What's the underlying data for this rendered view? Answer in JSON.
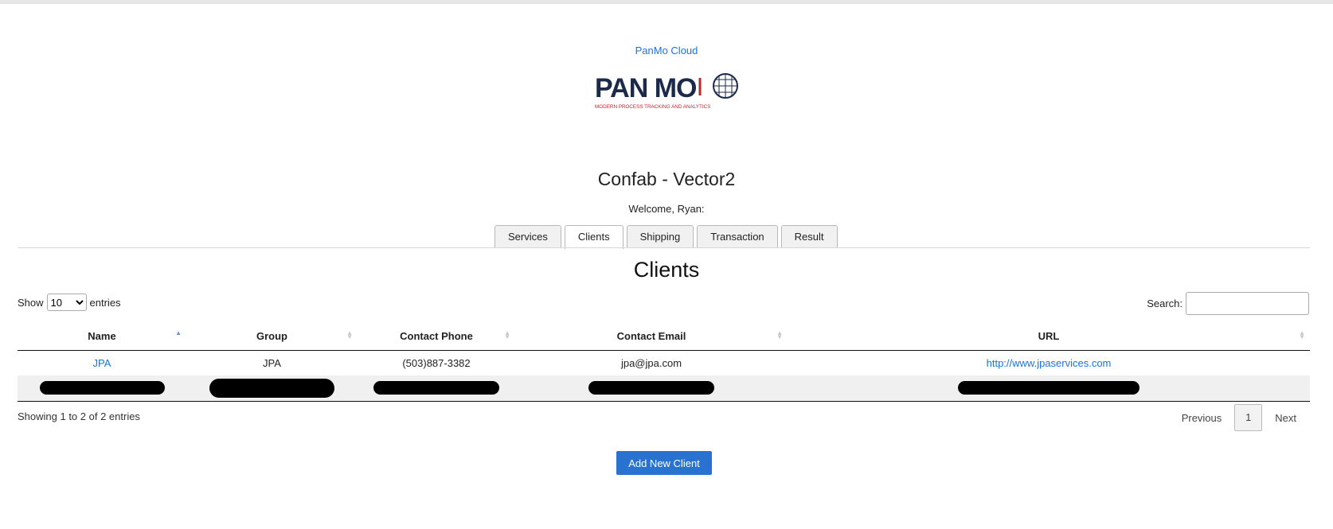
{
  "header": {
    "brand_link": "PanMo Cloud",
    "logo_text": "PAN MO",
    "logo_tagline": "MODERN PROCESS TRACKING AND ANALYTICS",
    "app_title": "Confab - Vector2",
    "welcome": "Welcome, Ryan:"
  },
  "tabs": [
    {
      "label": "Services",
      "active": false
    },
    {
      "label": "Clients",
      "active": true
    },
    {
      "label": "Shipping",
      "active": false
    },
    {
      "label": "Transaction",
      "active": false
    },
    {
      "label": "Result",
      "active": false
    }
  ],
  "section": {
    "title": "Clients"
  },
  "table_controls": {
    "show_label": "Show",
    "entries_label": "entries",
    "page_size": "10",
    "search_label": "Search:",
    "search_value": ""
  },
  "table": {
    "columns": [
      "Name",
      "Group",
      "Contact Phone",
      "Contact Email",
      "URL"
    ],
    "sorted_column": "Name",
    "rows": [
      {
        "name": "JPA",
        "group": "JPA",
        "phone": "(503)887-3382",
        "email": "jpa@jpa.com",
        "url": "http://www.jpaservices.com"
      },
      {
        "redacted": true
      }
    ]
  },
  "footer": {
    "info": "Showing 1 to 2 of 2 entries",
    "previous": "Previous",
    "page": "1",
    "next": "Next"
  },
  "actions": {
    "add_client": "Add New Client"
  },
  "colors": {
    "link": "#1a73e8",
    "button": "#2a72d0",
    "logo_navy": "#1b2a4a",
    "logo_red": "#c0262d"
  }
}
